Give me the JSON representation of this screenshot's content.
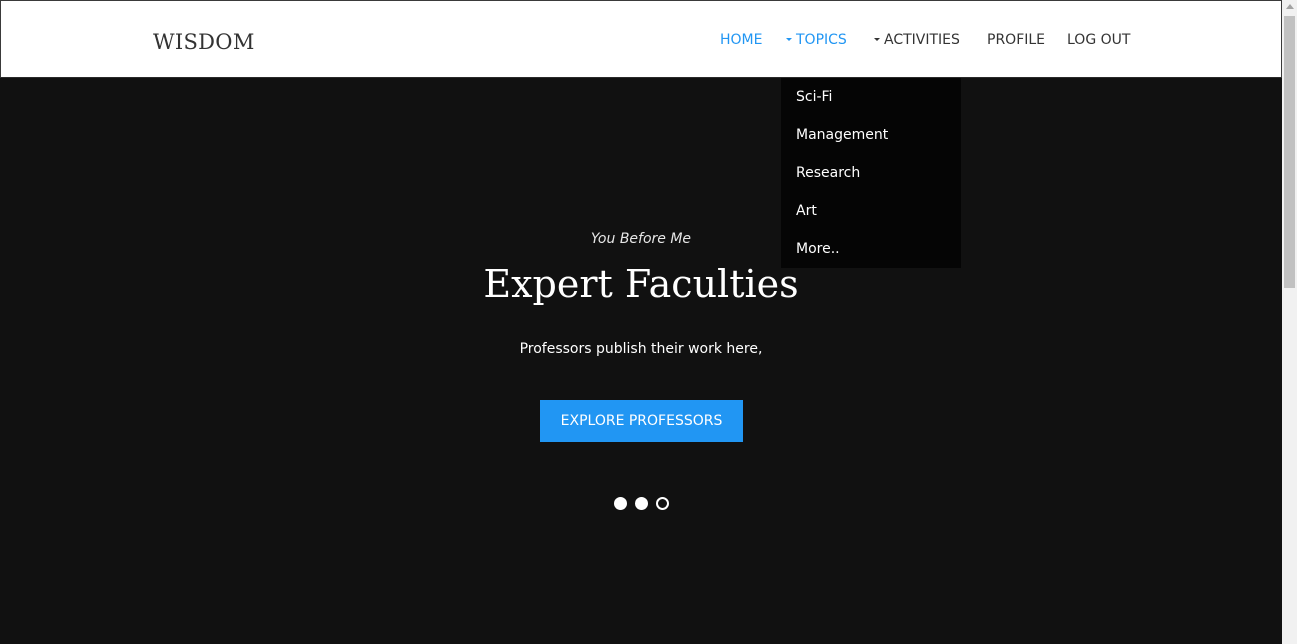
{
  "brand": {
    "name": "WISDOM"
  },
  "nav": {
    "items": [
      {
        "label": "HOME",
        "active": true,
        "dropdown": false
      },
      {
        "label": "TOPICS",
        "active": true,
        "dropdown": true
      },
      {
        "label": "ACTIVITIES",
        "active": false,
        "dropdown": true
      },
      {
        "label": "PROFILE",
        "active": false,
        "dropdown": false
      },
      {
        "label": "LOG OUT",
        "active": false,
        "dropdown": false
      }
    ]
  },
  "topics_menu": {
    "items": [
      "Sci-Fi",
      "Management",
      "Research",
      "Art",
      "More.."
    ]
  },
  "hero": {
    "subtitle": "You Before Me",
    "title": "Expert Faculties",
    "text": "Professors publish their work here,",
    "button_label": "EXPLORE PROFESSORS",
    "slides": [
      {
        "state": "filled"
      },
      {
        "state": "filled"
      },
      {
        "state": "empty"
      }
    ]
  },
  "colors": {
    "accent": "#2196f3",
    "hero_bg": "#111111",
    "dropdown_bg": "#050505",
    "nav_text": "#333333"
  },
  "icons": {
    "dropdown": "caret-down-icon"
  }
}
